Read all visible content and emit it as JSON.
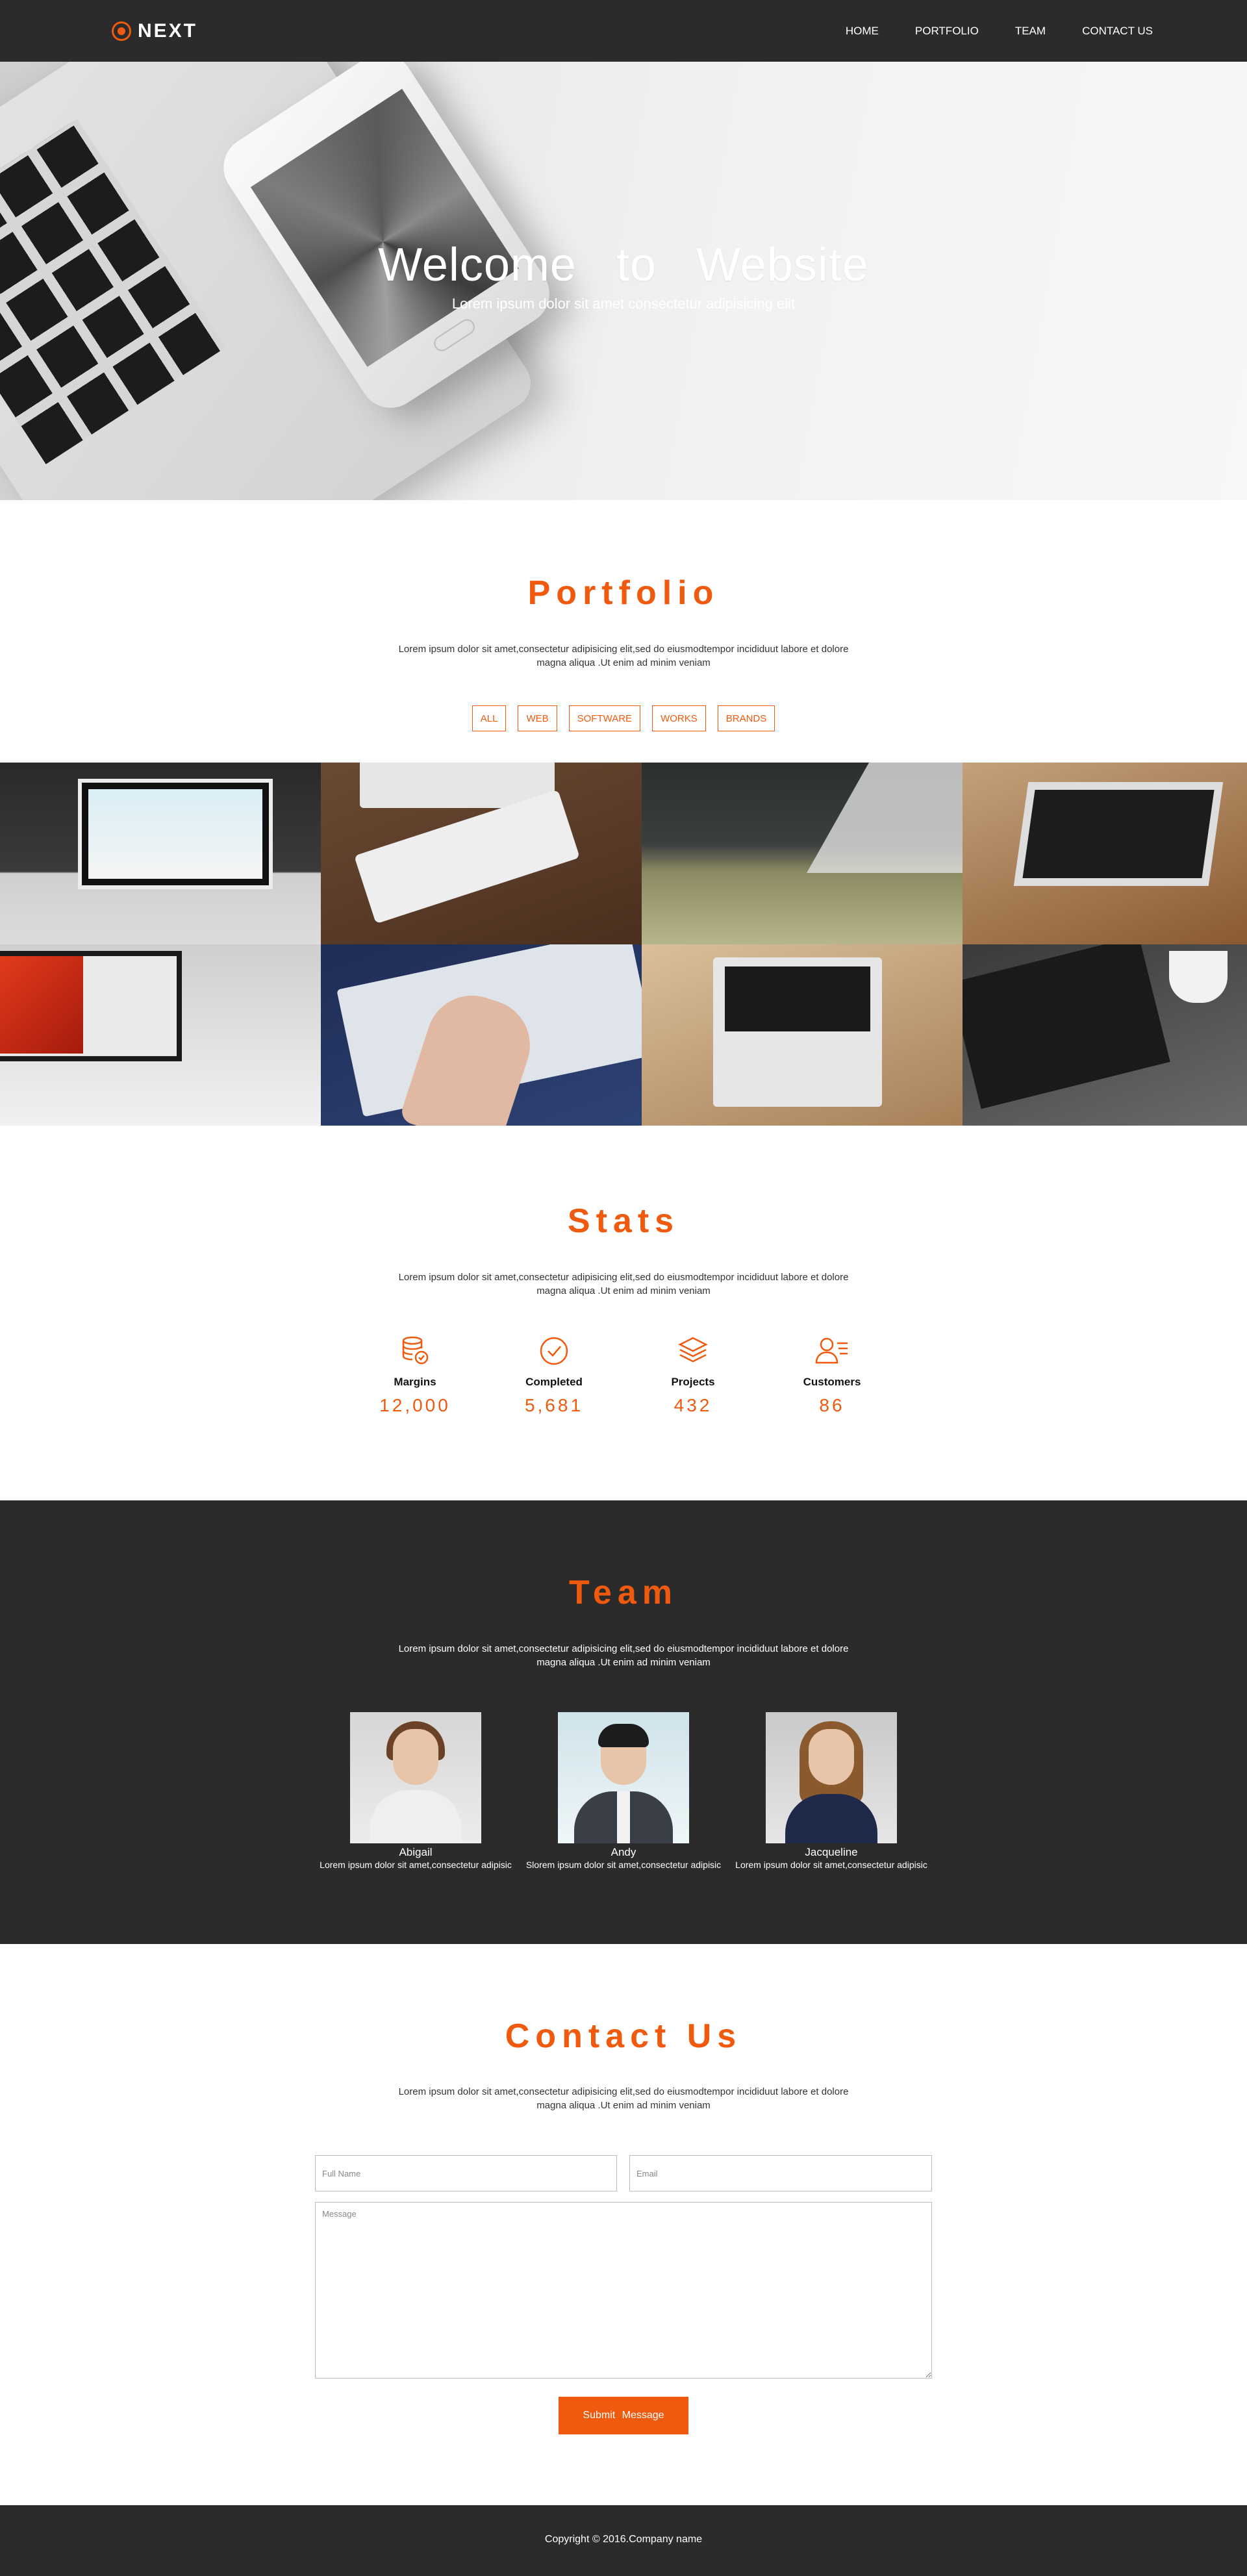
{
  "brand": {
    "name": "NEXT",
    "accent": "#f05a0e",
    "dark": "#2b2b2b"
  },
  "nav": {
    "items": [
      "HOME",
      "PORTFOLIO",
      "TEAM",
      "CONTACT US"
    ]
  },
  "hero": {
    "title": "Welcome to Website",
    "subtitle": "Lorem ipsum dolor sit amet consectetur adipisicing elit"
  },
  "portfolio": {
    "title": "Portfolio",
    "text": "Lorem ipsum dolor sit amet,consectetur adipisicing elit,sed do eiusmodtempor incididuut labore et dolore magna aliqua .Ut enim ad minim veniam",
    "filters": [
      "ALL",
      "WEB",
      "SOFTWARE",
      "WORKS",
      "BRANDS"
    ]
  },
  "stats": {
    "title": "Stats",
    "text": "Lorem ipsum dolor sit amet,consectetur adipisicing elit,sed do eiusmodtempor incididuut labore et dolore magna aliqua .Ut enim ad minim veniam",
    "items": [
      {
        "icon": "database-check-icon",
        "label": "Margins",
        "value": "12,000"
      },
      {
        "icon": "check-circle-icon",
        "label": "Completed",
        "value": "5,681"
      },
      {
        "icon": "layers-icon",
        "label": "Projects",
        "value": "432"
      },
      {
        "icon": "user-list-icon",
        "label": "Customers",
        "value": "86"
      }
    ]
  },
  "team": {
    "title": "Team",
    "text": "Lorem ipsum dolor sit amet,consectetur adipisicing elit,sed do eiusmodtempor incididuut labore et dolore magna aliqua .Ut enim ad minim veniam",
    "members": [
      {
        "name": "Abigail",
        "desc": "Lorem ipsum dolor sit amet,consectetur adipisic"
      },
      {
        "name": "Andy",
        "desc": "Slorem ipsum dolor sit amet,consectetur adipisic"
      },
      {
        "name": "Jacqueline",
        "desc": "Lorem ipsum dolor sit amet,consectetur adipisic"
      }
    ]
  },
  "contact": {
    "title": "Contact Us",
    "text": "Lorem ipsum dolor sit amet,consectetur adipisicing elit,sed do eiusmodtempor incididuut labore et dolore magna aliqua .Ut enim ad minim veniam",
    "name_placeholder": "Full Name",
    "email_placeholder": "Email",
    "message_placeholder": "Message",
    "submit_label": "Submit Message"
  },
  "footer": {
    "copyright": "Copyright © 2016.Company name"
  }
}
